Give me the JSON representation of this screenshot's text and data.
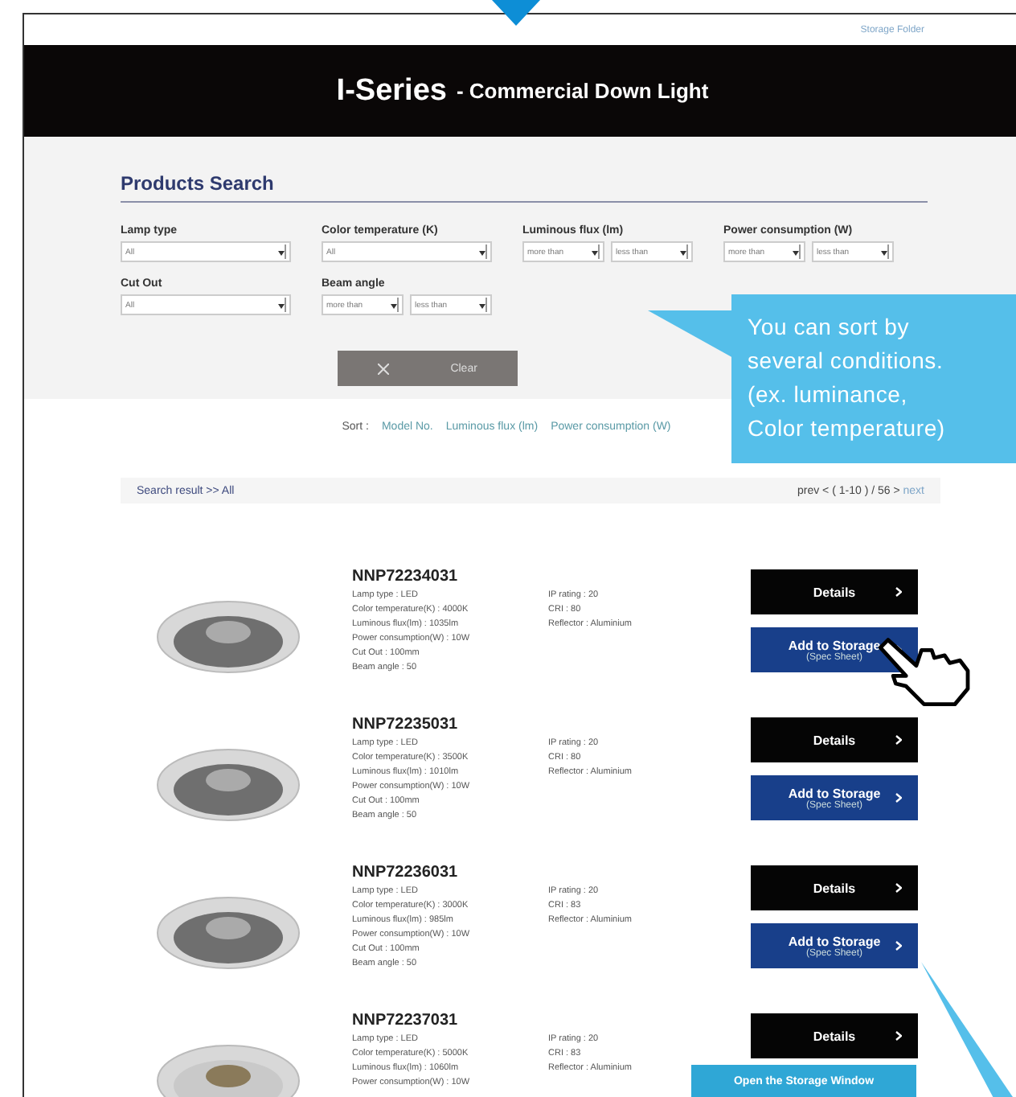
{
  "top_link": "Storage Folder",
  "header": {
    "title": "I-Series",
    "subtitle": "- Commercial Down Light"
  },
  "search": {
    "title": "Products Search",
    "filters": [
      {
        "label": "Lamp type",
        "selects": [
          "All"
        ]
      },
      {
        "label": "Color temperature (K)",
        "selects": [
          "All"
        ]
      },
      {
        "label": "Luminous flux (lm)",
        "selects": [
          "more than",
          "less than"
        ]
      },
      {
        "label": "Power consumption (W)",
        "selects": [
          "more than",
          "less than"
        ]
      },
      {
        "label": "Cut Out",
        "selects": [
          "All"
        ]
      },
      {
        "label": "Beam angle",
        "selects": [
          "more than",
          "less than"
        ]
      }
    ],
    "clear_button": "Clear"
  },
  "sort": {
    "label": "Sort :",
    "options": [
      "Model No.",
      "Luminous flux (lm)",
      "Power consumption (W)"
    ]
  },
  "result_bar": {
    "breadcrumb": "Search result >> All",
    "pager": "prev < ( 1-10 ) / 56 >",
    "next": "next"
  },
  "products": [
    {
      "model": "NNP72234031",
      "specs": [
        "Lamp type : LED",
        "Color temperature(K) : 4000K",
        "Luminous flux(lm) : 1035lm",
        "Power consumption(W) : 10W",
        "Cut Out : 100mm",
        "Beam angle : 50"
      ],
      "specs2": [
        "IP rating : 20",
        "CRI : 80",
        "Reflector : Aluminium"
      ],
      "details": "Details",
      "storage": "Add to Storage",
      "storage_sub": "(Spec Sheet)",
      "lens": false
    },
    {
      "model": "NNP72235031",
      "specs": [
        "Lamp type : LED",
        "Color temperature(K) : 3500K",
        "Luminous flux(lm) : 1010lm",
        "Power consumption(W) : 10W",
        "Cut Out : 100mm",
        "Beam angle : 50"
      ],
      "specs2": [
        "IP rating : 20",
        "CRI : 80",
        "Reflector : Aluminium"
      ],
      "details": "Details",
      "storage": "Add to Storage",
      "storage_sub": "(Spec Sheet)",
      "lens": false
    },
    {
      "model": "NNP72236031",
      "specs": [
        "Lamp type : LED",
        "Color temperature(K) : 3000K",
        "Luminous flux(lm) : 985lm",
        "Power consumption(W) : 10W",
        "Cut Out : 100mm",
        "Beam angle : 50"
      ],
      "specs2": [
        "IP rating : 20",
        "CRI : 83",
        "Reflector : Aluminium"
      ],
      "details": "Details",
      "storage": "Add to Storage",
      "storage_sub": "(Spec Sheet)",
      "lens": false
    },
    {
      "model": "NNP72237031",
      "specs": [
        "Lamp type : LED",
        "Color temperature(K) : 5000K",
        "Luminous flux(lm) : 1060lm",
        "Power consumption(W) : 10W"
      ],
      "specs2": [
        "IP rating : 20",
        "CRI : 83",
        "Reflector : Aluminium"
      ],
      "details": "Details",
      "lens": true
    }
  ],
  "storage_window_button": "Open the Storage Window",
  "callout": [
    "You can sort by",
    "several conditions.",
    "(ex. luminance,",
    "Color temperature)"
  ]
}
